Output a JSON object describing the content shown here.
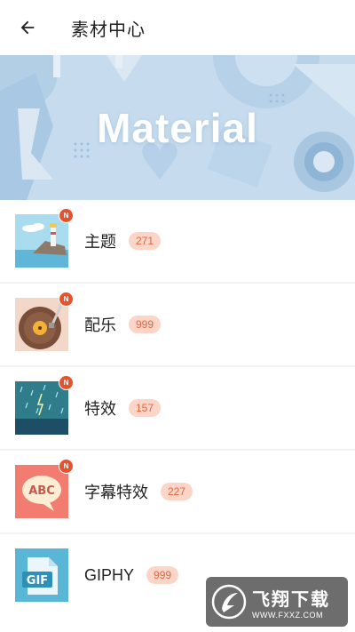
{
  "header": {
    "title": "素材中心",
    "back_icon": "arrow-left-icon"
  },
  "banner": {
    "text": "Material",
    "background": "#c9def0"
  },
  "items": [
    {
      "label": "主题",
      "count": "271",
      "badge": "N",
      "icon": "lighthouse-thumbnail"
    },
    {
      "label": "配乐",
      "count": "999",
      "badge": "N",
      "icon": "record-player-thumbnail"
    },
    {
      "label": "特效",
      "count": "157",
      "badge": "N",
      "icon": "rain-effect-thumbnail"
    },
    {
      "label": "字幕特效",
      "count": "227",
      "badge": "N",
      "icon": "abc-speech-bubble-thumbnail"
    },
    {
      "label": "GIPHY",
      "count": "999",
      "icon": "gif-file-thumbnail"
    }
  ],
  "watermark": {
    "title": "飞翔下载",
    "url": "WWW.FXXZ.COM"
  },
  "colors": {
    "badge": "#e5522c",
    "count_bg": "#fbd5c8",
    "count_text": "#e0663e"
  }
}
